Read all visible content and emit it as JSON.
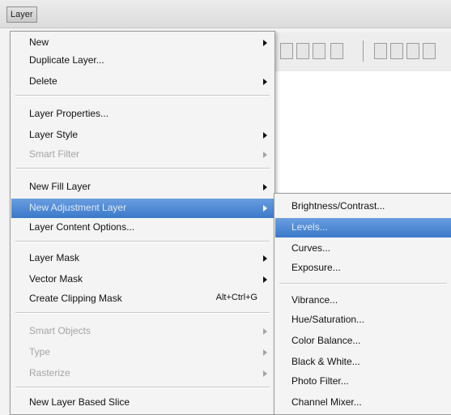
{
  "menubar": {
    "layer_label": "Layer"
  },
  "layer_menu": {
    "new": "New",
    "duplicate_layer": "Duplicate Layer...",
    "delete": "Delete",
    "layer_properties": "Layer Properties...",
    "layer_style": "Layer Style",
    "smart_filter": "Smart Filter",
    "new_fill_layer": "New Fill Layer",
    "new_adjustment_layer": "New Adjustment Layer",
    "layer_content_options": "Layer Content Options...",
    "layer_mask": "Layer Mask",
    "vector_mask": "Vector Mask",
    "create_clipping_mask": "Create Clipping Mask",
    "create_clipping_mask_shortcut": "Alt+Ctrl+G",
    "smart_objects": "Smart Objects",
    "type": "Type",
    "rasterize": "Rasterize",
    "new_layer_based_slice": "New Layer Based Slice"
  },
  "adjustment_submenu": {
    "brightness_contrast": "Brightness/Contrast...",
    "levels": "Levels...",
    "curves": "Curves...",
    "exposure": "Exposure...",
    "vibrance": "Vibrance...",
    "hue_saturation": "Hue/Saturation...",
    "color_balance": "Color Balance...",
    "black_white": "Black & White...",
    "photo_filter": "Photo Filter...",
    "channel_mixer": "Channel Mixer..."
  }
}
